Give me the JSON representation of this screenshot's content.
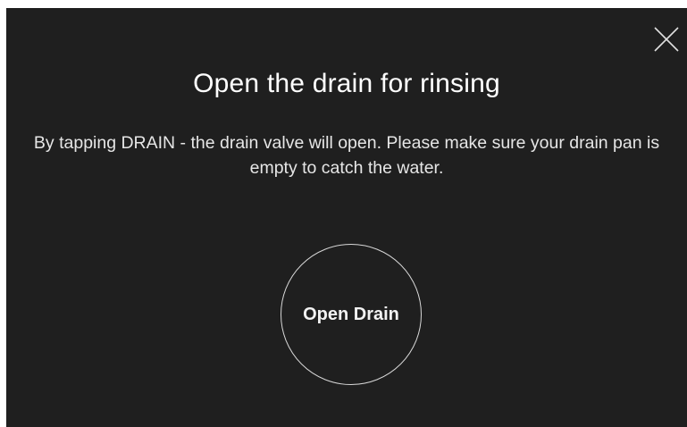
{
  "dialog": {
    "title": "Open the drain for rinsing",
    "description": "By tapping DRAIN - the drain valve will open. Please make sure your drain pan is empty to catch the water.",
    "action_label": "Open Drain",
    "close_icon": "close-icon"
  },
  "colors": {
    "background": "#1f1f1f",
    "text": "#ffffff",
    "circle_border": "#d8d8d8"
  }
}
